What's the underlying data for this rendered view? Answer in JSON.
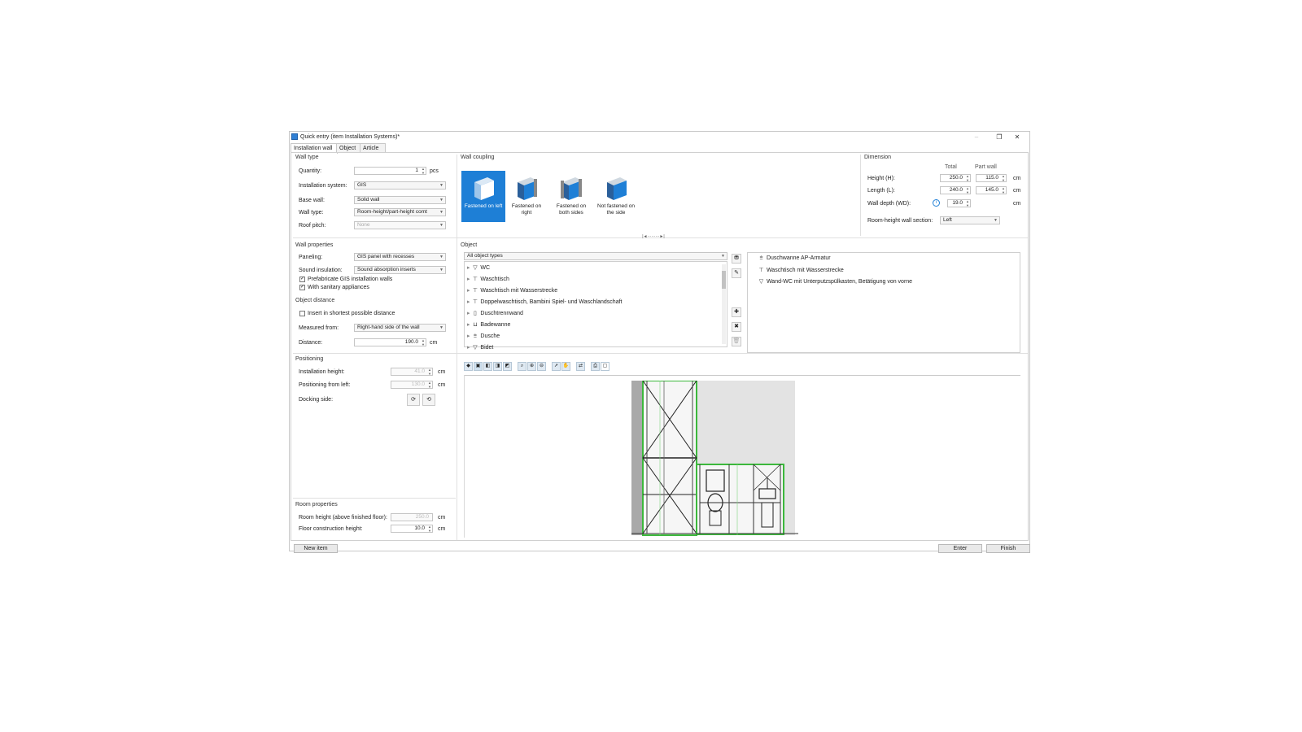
{
  "window": {
    "title": "Quick entry (item Installation Systems)*"
  },
  "tabs": [
    {
      "label": "Installation wall"
    },
    {
      "label": "Object"
    },
    {
      "label": "Article"
    }
  ],
  "wall_type": {
    "section": "Wall type",
    "quantity_label": "Quantity:",
    "quantity_value": "1",
    "quantity_unit": "pcs",
    "system_label": "Installation system:",
    "system_value": "GIS",
    "base_label": "Base wall:",
    "base_value": "Solid wall",
    "type_label": "Wall type:",
    "type_value": "Room-height/part-height comt",
    "roof_label": "Roof pitch:",
    "roof_value": "None"
  },
  "wall_coupling": {
    "section": "Wall coupling",
    "options": [
      {
        "label": "Fastened on left",
        "selected": true
      },
      {
        "label": "Fastened on right",
        "selected": false
      },
      {
        "label": "Fastened on both sides",
        "selected": false
      },
      {
        "label": "Not fastened on the side",
        "selected": false
      }
    ]
  },
  "dimension": {
    "section": "Dimension",
    "col_total": "Total",
    "col_part": "Part wall",
    "height_label": "Height (H):",
    "height_total": "250.0",
    "height_part": "115.0",
    "length_label": "Length (L):",
    "length_total": "240.0",
    "length_part": "145.0",
    "depth_label": "Wall depth (WD):",
    "depth_total": "19.0",
    "unit": "cm",
    "section_label": "Room-height wall section:",
    "section_value": "Left"
  },
  "wall_properties": {
    "section": "Wall properties",
    "paneling_label": "Paneling:",
    "paneling_value": "GIS panel with recesses",
    "sound_label": "Sound insulation:",
    "sound_value": "Sound absorption inserts",
    "prefab_label": "Prefabricate GIS installation walls",
    "prefab_checked": true,
    "sanitary_label": "With sanitary appliances",
    "sanitary_checked": true
  },
  "object_distance": {
    "section": "Object distance",
    "shortest_label": "Insert in shortest possible distance",
    "shortest_checked": false,
    "measured_label": "Measured from:",
    "measured_value": "Right-hand side of the wall",
    "distance_label": "Distance:",
    "distance_value": "190.0",
    "distance_unit": "cm"
  },
  "object": {
    "section": "Object",
    "filter_value": "All object types",
    "items": [
      {
        "label": "WC",
        "icon": "wc-icon"
      },
      {
        "label": "Waschtisch",
        "icon": "washbasin-icon"
      },
      {
        "label": "Waschtisch mit Wasserstrecke",
        "icon": "washbasin-icon"
      },
      {
        "label": "Doppelwaschtisch, Bambini Spiel- und Waschlandschaft",
        "icon": "double-washbasin-icon"
      },
      {
        "label": "Duschtrennwand",
        "icon": "shower-partition-icon"
      },
      {
        "label": "Badewanne",
        "icon": "bathtub-icon"
      },
      {
        "label": "Dusche",
        "icon": "shower-icon"
      },
      {
        "label": "Bidet",
        "icon": "bidet-icon"
      }
    ],
    "selected": [
      {
        "label": "Duschwanne AP-Armatur",
        "icon": "shower-tray-icon"
      },
      {
        "label": "Waschtisch mit Wasserstrecke",
        "icon": "washbasin-icon"
      },
      {
        "label": "Wand-WC mit Unterputzspülkasten, Betätigung von vorne",
        "icon": "wc-icon"
      }
    ]
  },
  "positioning": {
    "section": "Positioning",
    "height_label": "Installation height:",
    "height_value": "41.0",
    "left_label": "Positioning from left:",
    "left_value": "130.0",
    "unit": "cm",
    "docking_label": "Docking side:"
  },
  "room_properties": {
    "section": "Room properties",
    "room_height_label": "Room height (above finished floor):",
    "room_height_value": "250.0",
    "floor_label": "Floor construction height:",
    "floor_value": "10.0",
    "unit": "cm"
  },
  "buttons": {
    "new_item": "New item",
    "enter": "Enter",
    "finish": "Finish"
  },
  "colors": {
    "accent": "#1e7fd6",
    "frame_green": "#3cb83c"
  }
}
